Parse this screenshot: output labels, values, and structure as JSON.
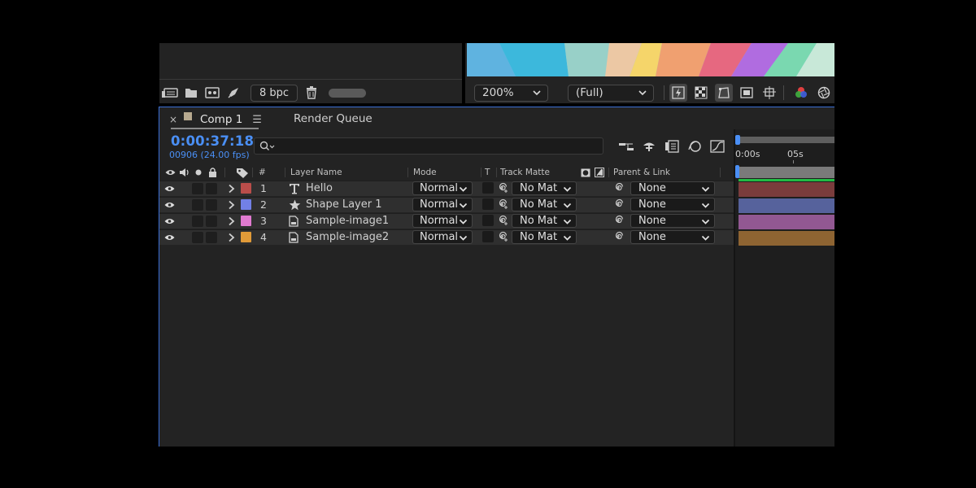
{
  "project_panel": {
    "bpc_label": "8 bpc",
    "icons": [
      "interpret-footage-icon",
      "new-folder-icon",
      "new-composition-icon",
      "render-rocket-icon",
      "trash-icon"
    ]
  },
  "viewer": {
    "zoom": "200%",
    "resolution": "(Full)",
    "icons": [
      "fast-preview-icon",
      "transparency-grid-icon",
      "mask-path-icon",
      "region-of-interest-icon",
      "guides-icon",
      "color-channels-icon",
      "exposure-icon"
    ]
  },
  "timeline": {
    "tabs": [
      {
        "label": "Comp 1",
        "active": true,
        "color": "#b7a98f"
      },
      {
        "label": "Render Queue",
        "active": false
      }
    ],
    "close_glyph": "×",
    "menu_glyph": "☰",
    "current_time": "0:00:37:18",
    "frame_info": "00906 (24.00 fps)",
    "search_placeholder": "",
    "columns": {
      "num": "#",
      "layer_name": "Layer Name",
      "mode": "Mode",
      "t": "T",
      "track_matte": "Track Matte",
      "parent_link": "Parent & Link"
    },
    "ruler": {
      "start": "0:00s",
      "mark_5": "05s"
    },
    "layers": [
      {
        "num": "1",
        "name": "Hello",
        "type": "text-layer-icon",
        "label_color": "#b94d4a",
        "mode": "Normal",
        "track_matte": "No Mat",
        "parent": "None",
        "bar_color": "#7a3c3c"
      },
      {
        "num": "2",
        "name": "Shape Layer 1",
        "type": "shape-layer-icon",
        "label_color": "#7280e6",
        "mode": "Normal",
        "track_matte": "No Mat",
        "parent": "None",
        "bar_color": "#56629c"
      },
      {
        "num": "3",
        "name": "Sample-image1",
        "type": "footage-file-icon",
        "label_color": "#e07ad0",
        "mode": "Normal",
        "track_matte": "No Mat",
        "parent": "None",
        "bar_color": "#925892"
      },
      {
        "num": "4",
        "name": "Sample-image2",
        "type": "footage-file-icon",
        "label_color": "#e09a38",
        "mode": "Normal",
        "track_matte": "No Mat",
        "parent": "None",
        "bar_color": "#8e6432"
      }
    ]
  }
}
